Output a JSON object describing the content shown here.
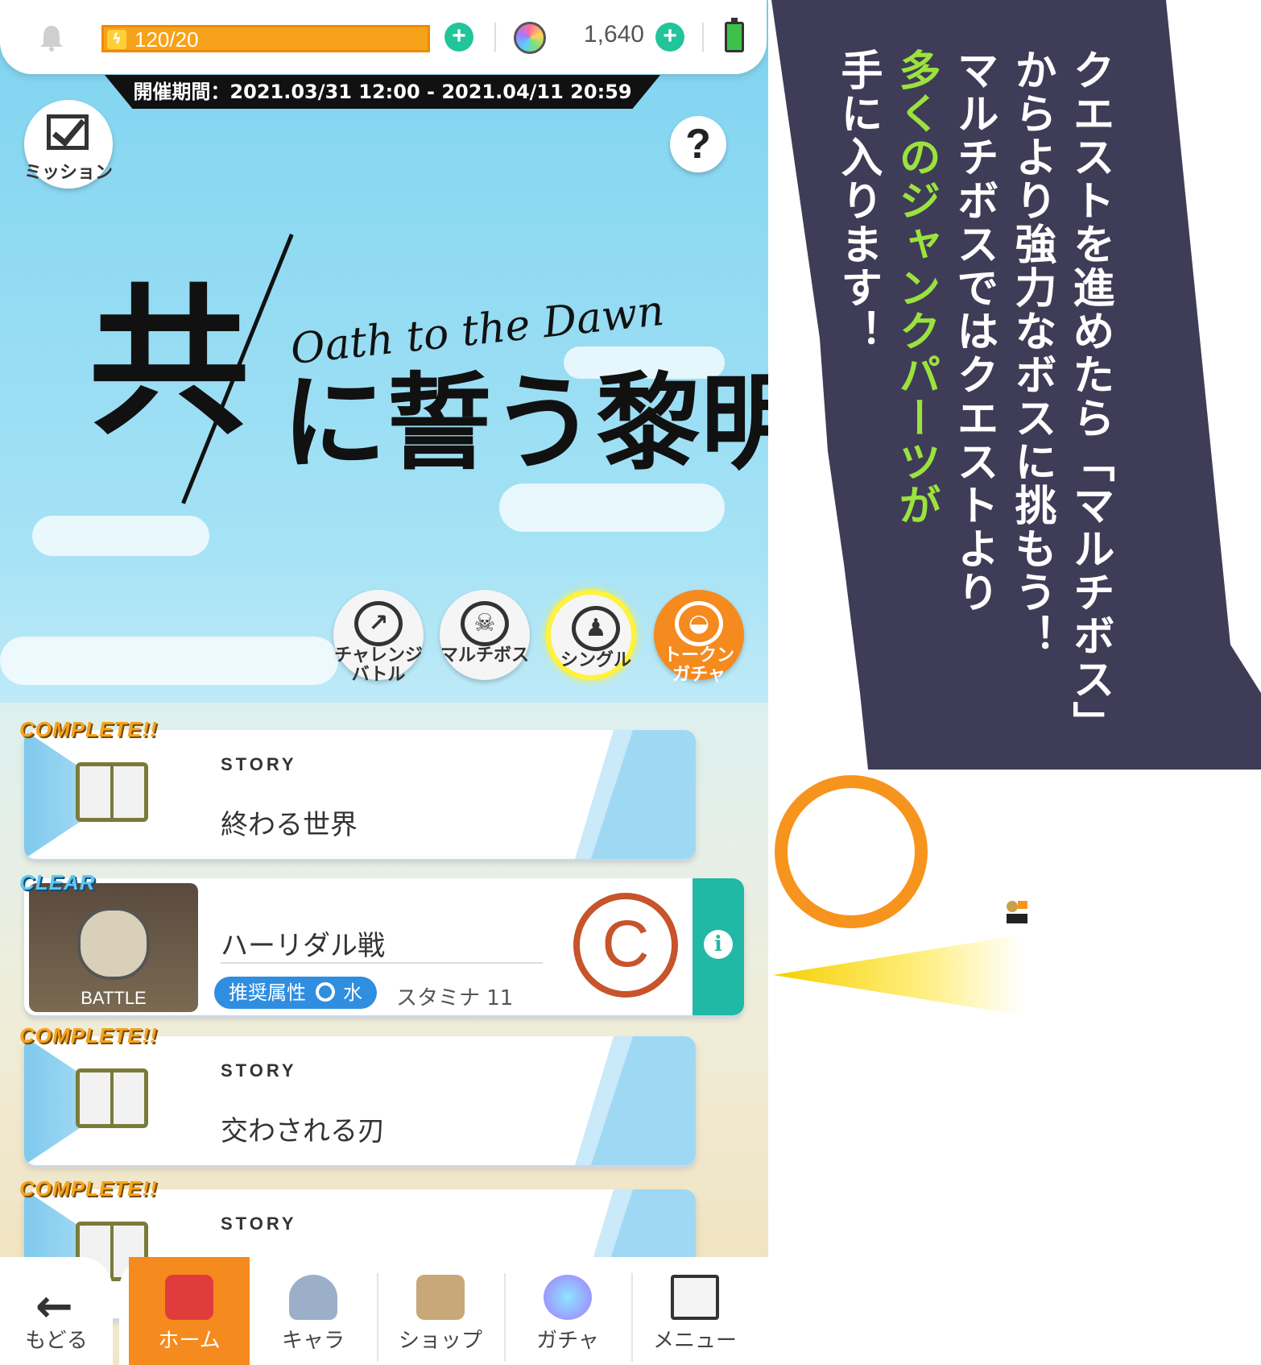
{
  "header": {
    "stamina": "120/20",
    "gem_count": "1,640",
    "period": "開催期間：2021.03/31 12:00 - 2021.04/11 20:59"
  },
  "mission": {
    "label": "ミッション"
  },
  "help": {
    "label": "?"
  },
  "logo": {
    "kanji_main": "共",
    "english": "Oath to the Dawn",
    "kanji_sub": "に誓う黎明"
  },
  "modes": [
    {
      "label": "チャレンジ\nバトル",
      "icon": "chart-icon"
    },
    {
      "label": "マルチボス",
      "icon": "demon-icon"
    },
    {
      "label": "シングル",
      "icon": "single-player-icon"
    },
    {
      "label": "トークン\nガチャ",
      "icon": "token-gacha-icon"
    }
  ],
  "quests": [
    {
      "badge": "COMPLETE!!",
      "kind": "STORY",
      "title": "終わる世界"
    },
    {
      "badge": "COMPLETE!!",
      "kind": "STORY",
      "title": "交わされる刃"
    },
    {
      "badge": "COMPLETE!!",
      "kind": "STORY",
      "title": ""
    }
  ],
  "battle": {
    "badge": "CLEAR",
    "thumb_label": "BATTLE",
    "title": "ハーリダル戦",
    "attr_label": "推奨属性",
    "attr_value": "水",
    "stamina_cost": "スタミナ 11",
    "rank": "C",
    "info": "i"
  },
  "nav": {
    "back": "もどる",
    "items": [
      {
        "label": "ホーム",
        "active": true
      },
      {
        "label": "キャラ",
        "active": false
      },
      {
        "label": "ショップ",
        "active": false
      },
      {
        "label": "ガチャ",
        "active": false
      },
      {
        "label": "メニュー",
        "active": false
      }
    ]
  },
  "banner": {
    "col1": "クエストを進めたら「マルチボス」",
    "col2": "からより強力なボスに挑もう！",
    "col3": "マルチボスではクエストより",
    "col4": "多くのジャンクパーツが",
    "col5": "手に入ります！"
  },
  "colors": {
    "accent_orange": "#f58a1f",
    "teal": "#22b8a6",
    "banner_bg": "#3f3c57",
    "banner_green": "#9be23e"
  }
}
